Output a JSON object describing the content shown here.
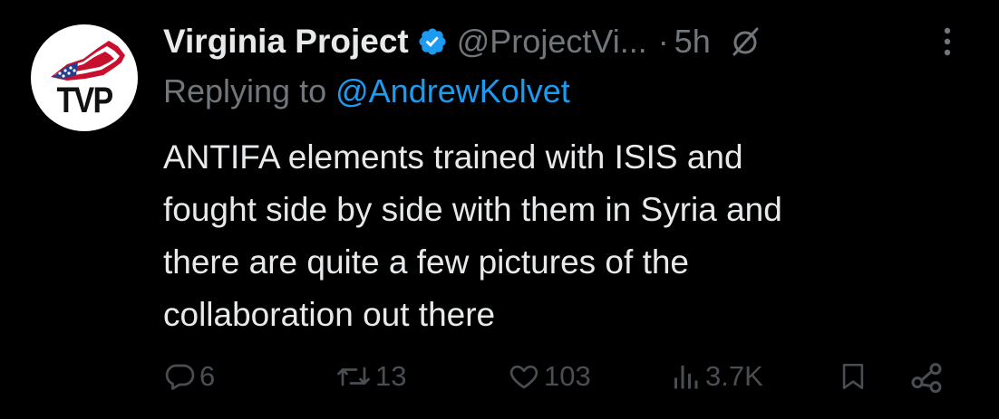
{
  "tweet": {
    "avatar_text": "TVP",
    "author_name": "Virginia Project",
    "handle": "@ProjectVi...",
    "separator": "·",
    "time": "5h",
    "replying_prefix": "Replying to ",
    "replying_to": "@AndrewKolvet",
    "body_lines": [
      "ANTIFA elements trained with ISIS and",
      "fought side by side with them in Syria and",
      "there are quite a few pictures of the",
      "collaboration out there"
    ]
  },
  "actions": {
    "replies": "6",
    "reposts": "13",
    "likes": "103",
    "views": "3.7K"
  },
  "icons": {
    "verified": "verified-badge-icon",
    "grok": "slash-circle-icon",
    "more": "more-vertical-icon",
    "reply": "reply-icon",
    "repost": "repost-icon",
    "like": "heart-icon",
    "views": "views-chart-icon",
    "bookmark": "bookmark-icon",
    "share": "share-icon"
  },
  "colors": {
    "background": "#000000",
    "primary_text": "#e7e9ea",
    "secondary_text": "#71767b",
    "link": "#1d9bf0",
    "action_gray": "#4a4e52",
    "verified_blue": "#1d9bf0"
  }
}
